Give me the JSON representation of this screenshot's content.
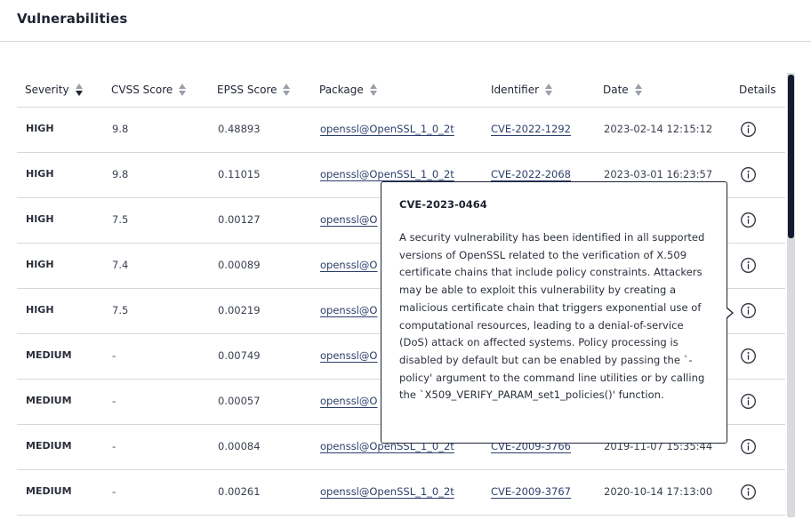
{
  "header": {
    "title": "Vulnerabilities"
  },
  "columns": {
    "severity": "Severity",
    "cvss": "CVSS Score",
    "epss": "EPSS Score",
    "package": "Package",
    "identifier": "Identifier",
    "date": "Date",
    "details": "Details"
  },
  "icons": {
    "info": "info-circle-icon",
    "sort": "sort-arrows-icon"
  },
  "rows": [
    {
      "severity": "HIGH",
      "cvss": "9.8",
      "epss": "0.48893",
      "package": "openssl@OpenSSL_1_0_2t",
      "identifier": "CVE-2022-1292",
      "date": "2023-02-14 12:15:12"
    },
    {
      "severity": "HIGH",
      "cvss": "9.8",
      "epss": "0.11015",
      "package": "openssl@OpenSSL_1_0_2t",
      "identifier": "CVE-2022-2068",
      "date": "2023-03-01 16:23:57"
    },
    {
      "severity": "HIGH",
      "cvss": "7.5",
      "epss": "0.00127",
      "package": "openssl@O",
      "identifier": "",
      "date": ""
    },
    {
      "severity": "HIGH",
      "cvss": "7.4",
      "epss": "0.00089",
      "package": "openssl@O",
      "identifier": "",
      "date": ""
    },
    {
      "severity": "HIGH",
      "cvss": "7.5",
      "epss": "0.00219",
      "package": "openssl@O",
      "identifier": "",
      "date": ""
    },
    {
      "severity": "MEDIUM",
      "cvss": "-",
      "epss": "0.00749",
      "package": "openssl@O",
      "identifier": "",
      "date": ""
    },
    {
      "severity": "MEDIUM",
      "cvss": "-",
      "epss": "0.00057",
      "package": "openssl@O",
      "identifier": "",
      "date": ""
    },
    {
      "severity": "MEDIUM",
      "cvss": "-",
      "epss": "0.00084",
      "package": "openssl@OpenSSL_1_0_2t",
      "identifier": "CVE-2009-3766",
      "date": "2019-11-07 15:35:44"
    },
    {
      "severity": "MEDIUM",
      "cvss": "-",
      "epss": "0.00261",
      "package": "openssl@OpenSSL_1_0_2t",
      "identifier": "CVE-2009-3767",
      "date": "2020-10-14 17:13:00"
    }
  ],
  "tooltip": {
    "title": "CVE-2023-0464",
    "body": "A security vulnerability has been identified in all supported versions of OpenSSL related to the verification of X.509 certificate chains that include policy constraints. Attackers may be able to exploit this vulnerability by creating a malicious certificate chain that triggers exponential use of computational resources, leading to a denial-of-service (DoS) attack on affected systems. Policy processing is disabled by default but can be enabled by passing the `-policy' argument to the command line utilities or by calling the `X509_VERIFY_PARAM_set1_policies()' function."
  },
  "colors": {
    "text": "#1f2433",
    "link": "#2c3e6b",
    "border": "#d6d8dc",
    "scroll_thumb": "#161b33"
  }
}
